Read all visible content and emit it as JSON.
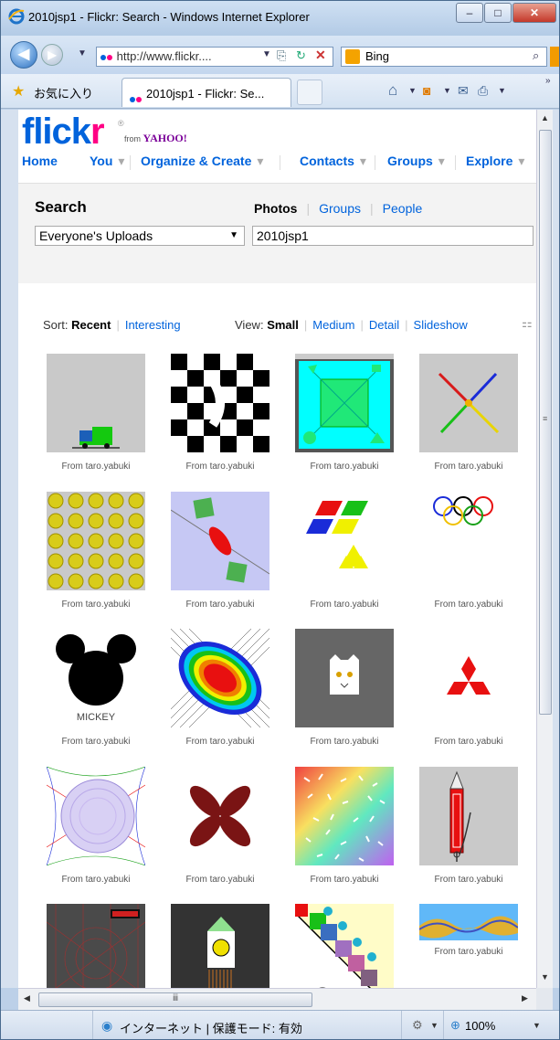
{
  "window": {
    "title": "2010jsp1 - Flickr: Search - Windows Internet Explorer",
    "minimize": "–",
    "maximize": "□",
    "close": "✕"
  },
  "address_bar": {
    "url": "http://www.flickr....",
    "search_engine": "Bing",
    "search_value": ""
  },
  "favorites_bar": {
    "favorites_label": "お気に入り",
    "tab_title": "2010jsp1 - Flickr: Se..."
  },
  "flickr": {
    "logo_flickr": "flick",
    "logo_r": "r",
    "from": "from",
    "yahoo": "YAHOO!",
    "menu": [
      "Home",
      "You",
      "Organize & Create",
      "Contacts",
      "Groups",
      "Explore"
    ]
  },
  "search": {
    "title": "Search",
    "tabs": [
      "Photos",
      "Groups",
      "People"
    ],
    "scope": "Everyone's Uploads",
    "query": "2010jsp1"
  },
  "sort_view": {
    "sort_label": "Sort:",
    "sort_options": [
      "Recent",
      "Interesting"
    ],
    "view_label": "View:",
    "view_options": [
      "Small",
      "Medium",
      "Detail",
      "Slideshow"
    ]
  },
  "photos": {
    "caption": "From taro.yabuki",
    "labels": {
      "mickey": "MICKEY"
    },
    "count_visible_captions": 16
  },
  "status_bar": {
    "zone": "インターネット | 保護モード: 有効",
    "zoom": "100%"
  },
  "colors": {
    "flickr_blue": "#0063dc",
    "flickr_pink": "#ff0084",
    "yahoo_purple": "#7b0099"
  }
}
